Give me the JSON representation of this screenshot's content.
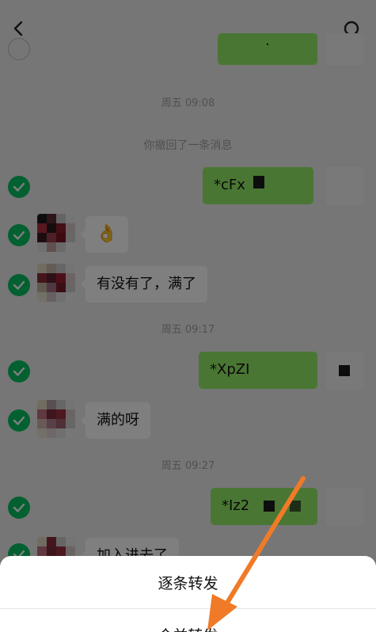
{
  "messages": {
    "partial_top_bubble": "·",
    "ts1": "周五 09:08",
    "recall_notice": "你撤回了一条消息",
    "out1_text": "*cFx",
    "in1_text": "👌",
    "in2_text": "有没有了，满了",
    "ts2": "周五 09:17",
    "out2_text": "*XpZI",
    "in3_text": "满的呀",
    "ts3": "周五 09:27",
    "out3_text": "*Iz2",
    "in4_text": "加入进去了"
  },
  "sheet": {
    "forward_one_by_one": "逐条转发",
    "forward_merged": "合并转发"
  },
  "colors": {
    "accent_green": "#07c160",
    "bubble_green": "#95ec69",
    "annotation_arrow": "#f07a28"
  }
}
